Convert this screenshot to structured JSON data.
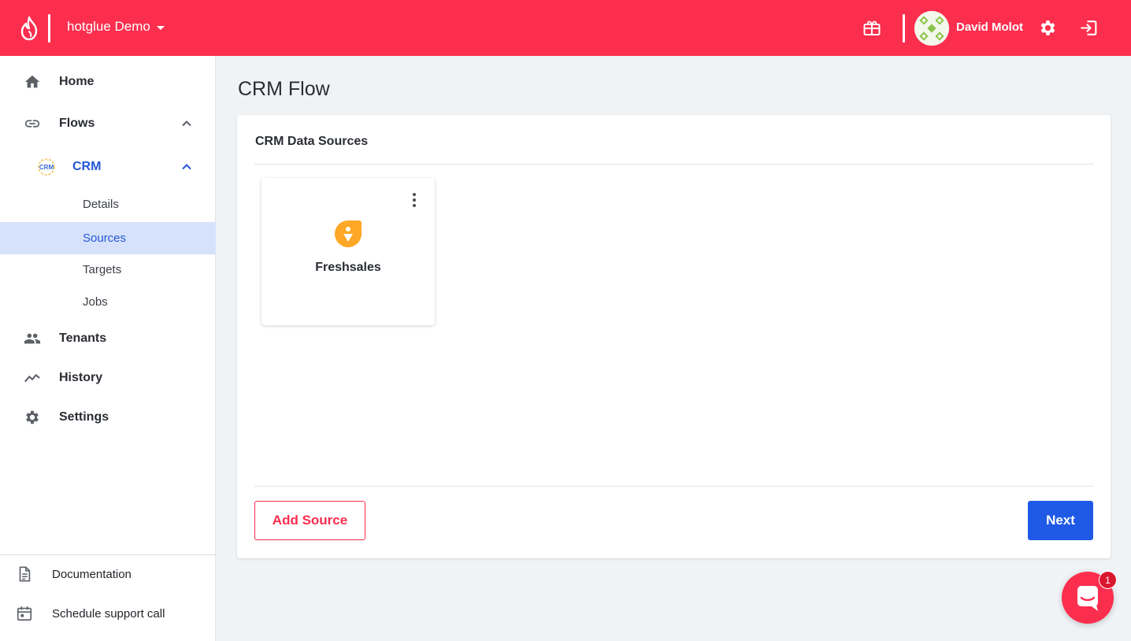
{
  "topbar": {
    "org_name": "hotglue Demo",
    "user_name": "David Molot",
    "brand_color": "#fb2e4e",
    "icons": [
      "flame-logo-icon",
      "gift-icon",
      "gear-icon",
      "logout-icon"
    ]
  },
  "sidebar": {
    "home": "Home",
    "flows": "Flows",
    "crm": "CRM",
    "crm_logo_text": "CRM",
    "sub_items": [
      "Details",
      "Sources",
      "Targets",
      "Jobs"
    ],
    "active_sub_item": "Sources",
    "tenants": "Tenants",
    "history": "History",
    "settings": "Settings",
    "documentation": "Documentation",
    "support": "Schedule support call"
  },
  "main": {
    "page_title": "CRM Flow",
    "card_title": "CRM Data Sources",
    "sources": [
      {
        "name": "Freshsales",
        "logo": "freshsales-logo",
        "logo_color": "#ffa726"
      }
    ],
    "add_source_label": "Add Source",
    "next_label": "Next",
    "accent_color": "#1f5ae6"
  },
  "chat": {
    "badge_count": "1"
  }
}
